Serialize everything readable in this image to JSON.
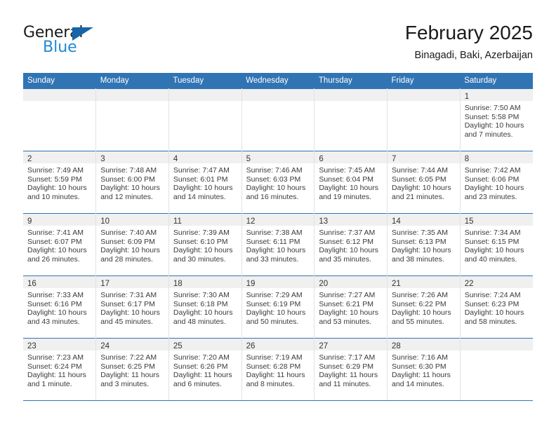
{
  "brand": {
    "name_top": "General",
    "name_bottom": "Blue",
    "accent_color": "#2389d6",
    "triangle_color": "#1565a8"
  },
  "header": {
    "title": "February 2025",
    "subtitle": "Binagadi, Baki, Azerbaijan"
  },
  "theme": {
    "header_row_bg": "#3174b4",
    "day_band_bg": "#f0f0f0",
    "grid_line": "#3174b4"
  },
  "weekday_headers": [
    "Sunday",
    "Monday",
    "Tuesday",
    "Wednesday",
    "Thursday",
    "Friday",
    "Saturday"
  ],
  "labels": {
    "sunrise_prefix": "Sunrise:",
    "sunset_prefix": "Sunset:",
    "daylight_prefix": "Daylight:"
  },
  "weeks": [
    [
      {
        "day": "",
        "sunrise": "",
        "sunset": "",
        "daylight": ""
      },
      {
        "day": "",
        "sunrise": "",
        "sunset": "",
        "daylight": ""
      },
      {
        "day": "",
        "sunrise": "",
        "sunset": "",
        "daylight": ""
      },
      {
        "day": "",
        "sunrise": "",
        "sunset": "",
        "daylight": ""
      },
      {
        "day": "",
        "sunrise": "",
        "sunset": "",
        "daylight": ""
      },
      {
        "day": "",
        "sunrise": "",
        "sunset": "",
        "daylight": ""
      },
      {
        "day": "1",
        "sunrise": "Sunrise: 7:50 AM",
        "sunset": "Sunset: 5:58 PM",
        "daylight": "Daylight: 10 hours and 7 minutes."
      }
    ],
    [
      {
        "day": "2",
        "sunrise": "Sunrise: 7:49 AM",
        "sunset": "Sunset: 5:59 PM",
        "daylight": "Daylight: 10 hours and 10 minutes."
      },
      {
        "day": "3",
        "sunrise": "Sunrise: 7:48 AM",
        "sunset": "Sunset: 6:00 PM",
        "daylight": "Daylight: 10 hours and 12 minutes."
      },
      {
        "day": "4",
        "sunrise": "Sunrise: 7:47 AM",
        "sunset": "Sunset: 6:01 PM",
        "daylight": "Daylight: 10 hours and 14 minutes."
      },
      {
        "day": "5",
        "sunrise": "Sunrise: 7:46 AM",
        "sunset": "Sunset: 6:03 PM",
        "daylight": "Daylight: 10 hours and 16 minutes."
      },
      {
        "day": "6",
        "sunrise": "Sunrise: 7:45 AM",
        "sunset": "Sunset: 6:04 PM",
        "daylight": "Daylight: 10 hours and 19 minutes."
      },
      {
        "day": "7",
        "sunrise": "Sunrise: 7:44 AM",
        "sunset": "Sunset: 6:05 PM",
        "daylight": "Daylight: 10 hours and 21 minutes."
      },
      {
        "day": "8",
        "sunrise": "Sunrise: 7:42 AM",
        "sunset": "Sunset: 6:06 PM",
        "daylight": "Daylight: 10 hours and 23 minutes."
      }
    ],
    [
      {
        "day": "9",
        "sunrise": "Sunrise: 7:41 AM",
        "sunset": "Sunset: 6:07 PM",
        "daylight": "Daylight: 10 hours and 26 minutes."
      },
      {
        "day": "10",
        "sunrise": "Sunrise: 7:40 AM",
        "sunset": "Sunset: 6:09 PM",
        "daylight": "Daylight: 10 hours and 28 minutes."
      },
      {
        "day": "11",
        "sunrise": "Sunrise: 7:39 AM",
        "sunset": "Sunset: 6:10 PM",
        "daylight": "Daylight: 10 hours and 30 minutes."
      },
      {
        "day": "12",
        "sunrise": "Sunrise: 7:38 AM",
        "sunset": "Sunset: 6:11 PM",
        "daylight": "Daylight: 10 hours and 33 minutes."
      },
      {
        "day": "13",
        "sunrise": "Sunrise: 7:37 AM",
        "sunset": "Sunset: 6:12 PM",
        "daylight": "Daylight: 10 hours and 35 minutes."
      },
      {
        "day": "14",
        "sunrise": "Sunrise: 7:35 AM",
        "sunset": "Sunset: 6:13 PM",
        "daylight": "Daylight: 10 hours and 38 minutes."
      },
      {
        "day": "15",
        "sunrise": "Sunrise: 7:34 AM",
        "sunset": "Sunset: 6:15 PM",
        "daylight": "Daylight: 10 hours and 40 minutes."
      }
    ],
    [
      {
        "day": "16",
        "sunrise": "Sunrise: 7:33 AM",
        "sunset": "Sunset: 6:16 PM",
        "daylight": "Daylight: 10 hours and 43 minutes."
      },
      {
        "day": "17",
        "sunrise": "Sunrise: 7:31 AM",
        "sunset": "Sunset: 6:17 PM",
        "daylight": "Daylight: 10 hours and 45 minutes."
      },
      {
        "day": "18",
        "sunrise": "Sunrise: 7:30 AM",
        "sunset": "Sunset: 6:18 PM",
        "daylight": "Daylight: 10 hours and 48 minutes."
      },
      {
        "day": "19",
        "sunrise": "Sunrise: 7:29 AM",
        "sunset": "Sunset: 6:19 PM",
        "daylight": "Daylight: 10 hours and 50 minutes."
      },
      {
        "day": "20",
        "sunrise": "Sunrise: 7:27 AM",
        "sunset": "Sunset: 6:21 PM",
        "daylight": "Daylight: 10 hours and 53 minutes."
      },
      {
        "day": "21",
        "sunrise": "Sunrise: 7:26 AM",
        "sunset": "Sunset: 6:22 PM",
        "daylight": "Daylight: 10 hours and 55 minutes."
      },
      {
        "day": "22",
        "sunrise": "Sunrise: 7:24 AM",
        "sunset": "Sunset: 6:23 PM",
        "daylight": "Daylight: 10 hours and 58 minutes."
      }
    ],
    [
      {
        "day": "23",
        "sunrise": "Sunrise: 7:23 AM",
        "sunset": "Sunset: 6:24 PM",
        "daylight": "Daylight: 11 hours and 1 minute."
      },
      {
        "day": "24",
        "sunrise": "Sunrise: 7:22 AM",
        "sunset": "Sunset: 6:25 PM",
        "daylight": "Daylight: 11 hours and 3 minutes."
      },
      {
        "day": "25",
        "sunrise": "Sunrise: 7:20 AM",
        "sunset": "Sunset: 6:26 PM",
        "daylight": "Daylight: 11 hours and 6 minutes."
      },
      {
        "day": "26",
        "sunrise": "Sunrise: 7:19 AM",
        "sunset": "Sunset: 6:28 PM",
        "daylight": "Daylight: 11 hours and 8 minutes."
      },
      {
        "day": "27",
        "sunrise": "Sunrise: 7:17 AM",
        "sunset": "Sunset: 6:29 PM",
        "daylight": "Daylight: 11 hours and 11 minutes."
      },
      {
        "day": "28",
        "sunrise": "Sunrise: 7:16 AM",
        "sunset": "Sunset: 6:30 PM",
        "daylight": "Daylight: 11 hours and 14 minutes."
      },
      {
        "day": "",
        "sunrise": "",
        "sunset": "",
        "daylight": ""
      }
    ]
  ]
}
